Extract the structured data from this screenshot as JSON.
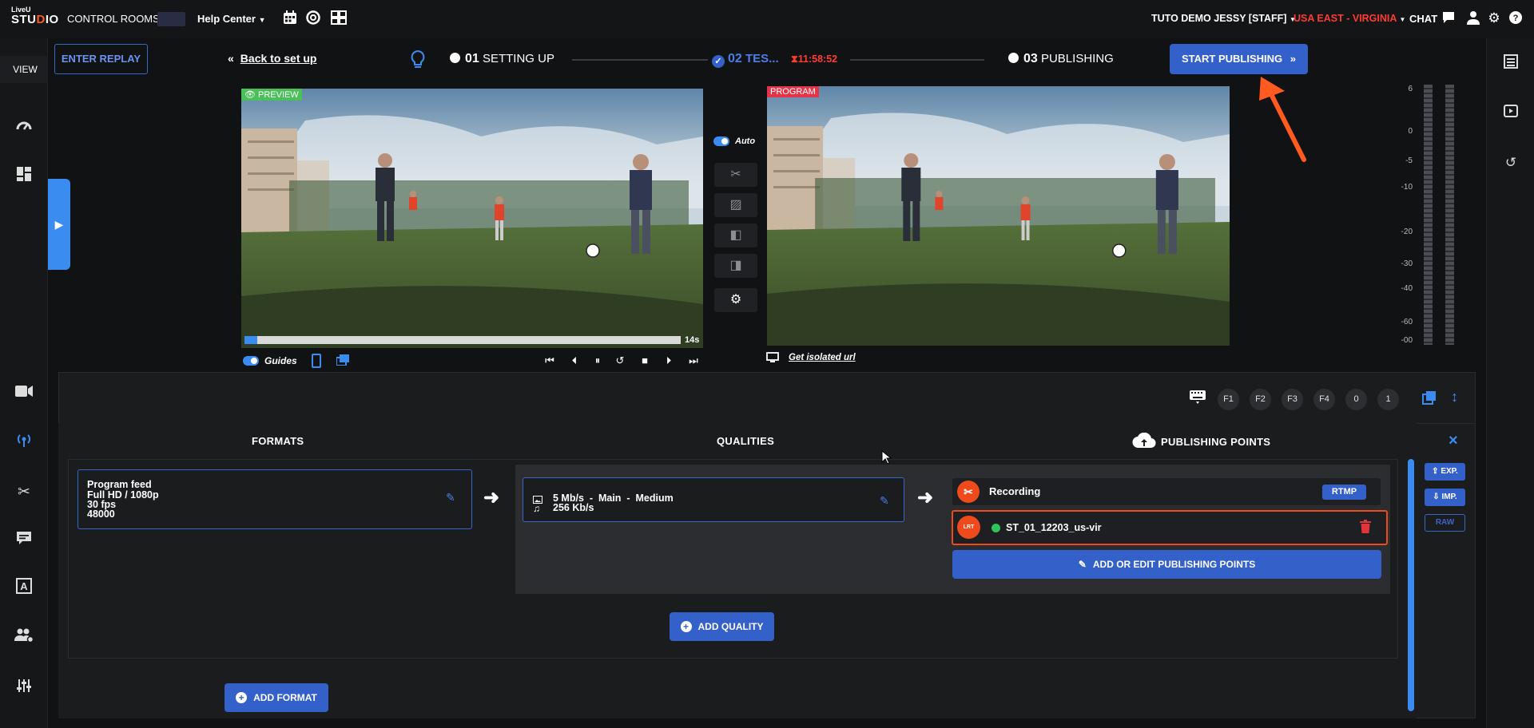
{
  "topbar": {
    "logo_line1": "LiveU",
    "logo_line2a": "STU",
    "logo_line2b": "D",
    "logo_line2c": "IO",
    "control_rooms": "CONTROL ROOMS",
    "help_center": "Help Center",
    "user": "TUTO DEMO JESSY [STAFF]",
    "region": "USA EAST - VIRGINIA",
    "chat": "CHAT"
  },
  "sidebar": {
    "view_label": "VIEW"
  },
  "steps": {
    "enter_replay": "ENTER REPLAY",
    "back": "Back to set up",
    "step1_num": "01",
    "step1_label": "SETTING UP",
    "step2_num": "02",
    "step2_label": "TES...",
    "timer": "11:58:52",
    "step3_num": "03",
    "step3_label": "PUBLISHING",
    "start_publishing": "START PUBLISHING"
  },
  "preview": {
    "badge": "PREVIEW",
    "duration": "14s",
    "progress": 0.03,
    "guides_label": "Guides"
  },
  "program": {
    "badge": "PROGRAM",
    "isolated_url": "Get isolated url"
  },
  "controls": {
    "auto_label": "Auto"
  },
  "audio_meter": {
    "labels": [
      "6",
      "0",
      "-5",
      "-10",
      "-20",
      "-30",
      "-40",
      "-60",
      "-00"
    ]
  },
  "shortcuts": [
    "F1",
    "F2",
    "F3",
    "F4",
    "0",
    "1"
  ],
  "columns": {
    "formats": "FORMATS",
    "qualities": "QUALITIES",
    "publishing_points": "PUBLISHING POINTS"
  },
  "format_card": {
    "line1": "Program feed",
    "line2": "Full HD / 1080p",
    "line3": "30 fps",
    "line4": "48000"
  },
  "quality_card": {
    "video": "5 Mb/s  -  Main  -  Medium",
    "audio": "256 Kb/s"
  },
  "publishing": {
    "recording_label": "Recording",
    "recording_tag": "RTMP",
    "point_icon": "LRT",
    "point_name": "ST_01_12203_us-vir",
    "add_or_edit": "ADD OR EDIT PUBLISHING POINTS"
  },
  "buttons": {
    "add_quality": "ADD QUALITY",
    "add_format": "ADD FORMAT",
    "export": "EXP.",
    "import": "IMP.",
    "raw": "RAW"
  },
  "colors": {
    "accent_blue": "#3460c9",
    "orange": "#ef4a1b",
    "red_region": "#ff3b30",
    "green_live": "#2ec55a"
  }
}
